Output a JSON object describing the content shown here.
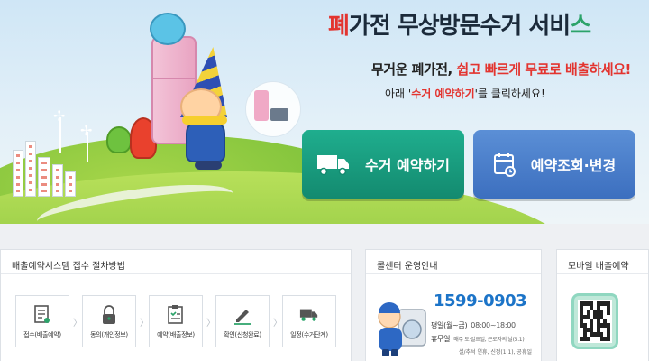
{
  "hero": {
    "title_part1": "폐",
    "title_part2": "가전 무상방문수거 서비",
    "title_part3": "스",
    "line1_a": "무거운 폐가전, ",
    "line1_b": "쉽고 빠르게 무료로 배출하세요!",
    "line2_a": "아래 '",
    "line2_b": "수거 예약하기",
    "line2_c": "'를 클릭하세요!"
  },
  "buttons": {
    "pickup": {
      "label": "수거 예약하기",
      "icon": "truck-icon",
      "color": "#1a9d80"
    },
    "inquiry": {
      "label": "예약조회·변경",
      "icon": "calendar-icon",
      "color": "#4a7fcb"
    }
  },
  "steps_panel": {
    "title": "배출예약시스템 접수 절차방법",
    "steps": [
      {
        "label": "접수(배출예약)",
        "icon": "document-icon"
      },
      {
        "label": "동의(개인정보)",
        "icon": "lock-icon"
      },
      {
        "label": "예약(배출정보)",
        "icon": "checklist-icon"
      },
      {
        "label": "확인(신청완료)",
        "icon": "pen-icon"
      },
      {
        "label": "일정(수거단계)",
        "icon": "truck-icon"
      }
    ]
  },
  "call_panel": {
    "title": "콜센터 운영안내",
    "number": "1599-0903",
    "weekday_label": "평일(월~금)",
    "weekday_hours": "08:00~18:00",
    "holiday_label": "휴무일",
    "holiday_text": "매주 토·일요일, 근로자의 날(5.1)",
    "holiday_text2": "설/추석 연휴, 신정(1.1), 공휴일"
  },
  "mobile_panel": {
    "title": "모바일 배출예약",
    "icon": "qr-code-icon"
  },
  "colors": {
    "accent_red": "#e3342f",
    "accent_green": "#2ca36a",
    "phone_blue": "#1c74c8"
  }
}
